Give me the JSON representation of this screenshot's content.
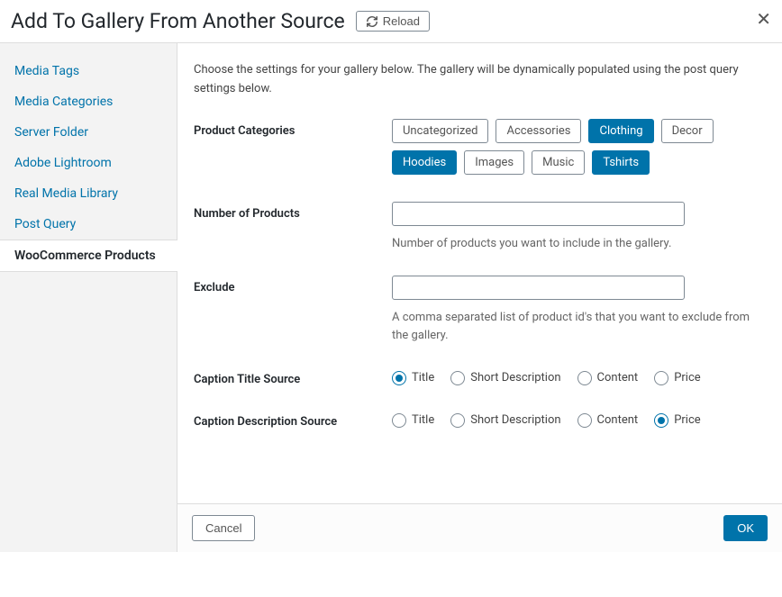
{
  "header": {
    "title": "Add To Gallery From Another Source",
    "reload_label": "Reload"
  },
  "sidebar": {
    "items": [
      {
        "label": "Media Tags",
        "active": false
      },
      {
        "label": "Media Categories",
        "active": false
      },
      {
        "label": "Server Folder",
        "active": false
      },
      {
        "label": "Adobe Lightroom",
        "active": false
      },
      {
        "label": "Real Media Library",
        "active": false
      },
      {
        "label": "Post Query",
        "active": false
      },
      {
        "label": "WooCommerce Products",
        "active": true
      }
    ]
  },
  "main": {
    "intro": "Choose the settings for your gallery below. The gallery will be dynamically populated using the post query settings below.",
    "product_categories": {
      "label": "Product Categories",
      "options": [
        {
          "label": "Uncategorized",
          "selected": false
        },
        {
          "label": "Accessories",
          "selected": false
        },
        {
          "label": "Clothing",
          "selected": true
        },
        {
          "label": "Decor",
          "selected": false
        },
        {
          "label": "Hoodies",
          "selected": true
        },
        {
          "label": "Images",
          "selected": false
        },
        {
          "label": "Music",
          "selected": false
        },
        {
          "label": "Tshirts",
          "selected": true
        }
      ]
    },
    "number_of_products": {
      "label": "Number of Products",
      "value": "",
      "help": "Number of products you want to include in the gallery."
    },
    "exclude": {
      "label": "Exclude",
      "value": "",
      "help": "A comma separated list of product id's that you want to exclude from the gallery."
    },
    "caption_title_source": {
      "label": "Caption Title Source",
      "options": [
        {
          "label": "Title",
          "checked": true
        },
        {
          "label": "Short Description",
          "checked": false
        },
        {
          "label": "Content",
          "checked": false
        },
        {
          "label": "Price",
          "checked": false
        }
      ]
    },
    "caption_description_source": {
      "label": "Caption Description Source",
      "options": [
        {
          "label": "Title",
          "checked": false
        },
        {
          "label": "Short Description",
          "checked": false
        },
        {
          "label": "Content",
          "checked": false
        },
        {
          "label": "Price",
          "checked": true
        }
      ]
    }
  },
  "footer": {
    "cancel_label": "Cancel",
    "ok_label": "OK"
  }
}
